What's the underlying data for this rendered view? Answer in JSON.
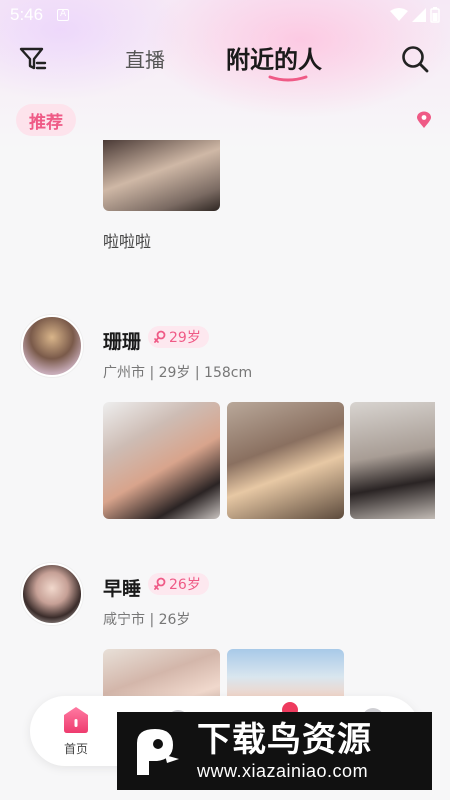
{
  "status_bar": {
    "time": "5:46",
    "notice_glyph": "A"
  },
  "nav": {
    "tab_live": "直播",
    "tab_nearby": "附近的人",
    "accent": "#ef5a86"
  },
  "filter_bar": {
    "recommend_label": "推荐"
  },
  "feed": {
    "first_caption": "啦啦啦",
    "users": [
      {
        "name": "珊珊",
        "age_label": "29岁",
        "info": "广州市 | 29岁 | 158cm"
      },
      {
        "name": "早睡",
        "age_label": "26岁",
        "info": "咸宁市 | 26岁"
      }
    ]
  },
  "bottom_nav": {
    "home_label": "首页"
  },
  "watermark": {
    "title": "下载鸟资源",
    "url": "www.xiazainiao.com"
  },
  "icons": [
    "filter-icon",
    "search-icon",
    "location-pin-icon",
    "female-icon",
    "home-icon"
  ]
}
